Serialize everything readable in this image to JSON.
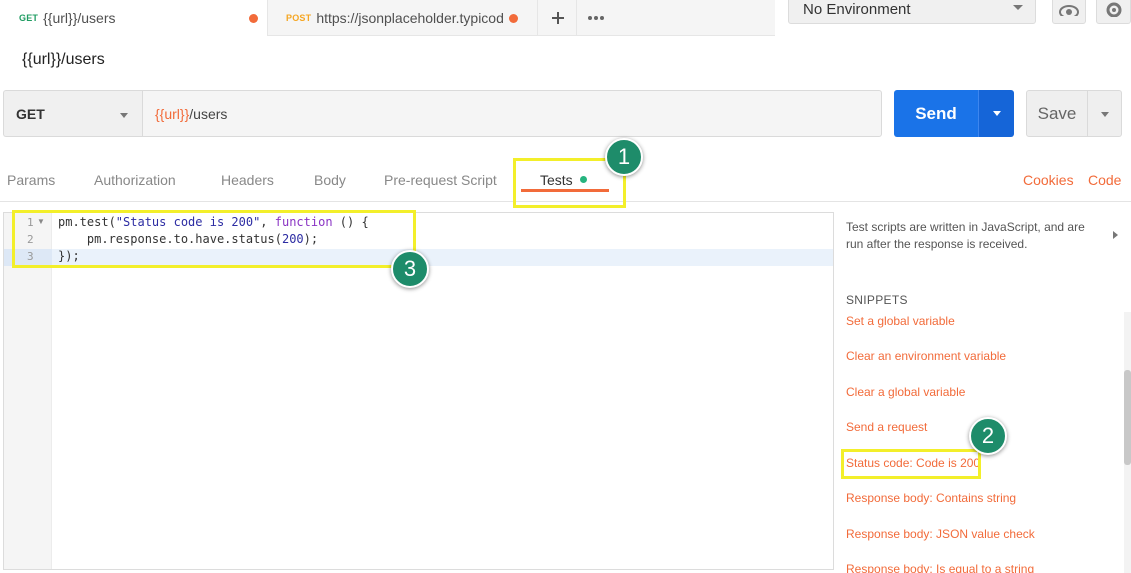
{
  "tabs": [
    {
      "method": "GET",
      "label": "{{url}}/users",
      "unsaved": true
    },
    {
      "method": "POST",
      "label": "https://jsonplaceholder.typicod",
      "unsaved": true
    }
  ],
  "tab_actions": {
    "new_tab_icon": "plus-icon",
    "more_icon": "ellipsis-icon"
  },
  "environment": {
    "selected": "No Environment"
  },
  "toolbar_icons": [
    "eye-icon",
    "gear-icon"
  ],
  "request_name": "{{url}}/users",
  "request": {
    "method": "GET",
    "url_variable": "{{url}}",
    "url_path": "/users",
    "send_label": "Send",
    "save_label": "Save"
  },
  "subtabs": [
    {
      "label": "Params"
    },
    {
      "label": "Authorization"
    },
    {
      "label": "Headers"
    },
    {
      "label": "Body"
    },
    {
      "label": "Pre-request Script"
    },
    {
      "label": "Tests",
      "active": true,
      "indicator": true
    }
  ],
  "right_links": {
    "cookies": "Cookies",
    "code": "Code"
  },
  "editor": {
    "line_numbers": [
      "1",
      "2",
      "3"
    ],
    "line1": {
      "a": "pm.test(",
      "b": "\"Status code is 200\"",
      "c": ", ",
      "d": "function",
      "e": " () {"
    },
    "line2": {
      "a": "    pm.response.to.have.status(",
      "b": "200",
      "c": ");"
    },
    "line3": "});"
  },
  "snippets_panel": {
    "description": "Test scripts are written in JavaScript, and are run after the response is received.",
    "heading": "SNIPPETS",
    "items": [
      "Set a global variable",
      "Clear an environment variable",
      "Clear a global variable",
      "Send a request",
      "Status code: Code is 200",
      "Response body: Contains string",
      "Response body: JSON value check",
      "Response body: Is equal to a string"
    ]
  },
  "annotations": [
    "1",
    "2",
    "3"
  ],
  "colors": {
    "accent": "#f26b3a",
    "send": "#1a73e8",
    "highlight": "#f3ef2a",
    "badge": "#1e8c6a",
    "indicator": "#26b47f"
  }
}
